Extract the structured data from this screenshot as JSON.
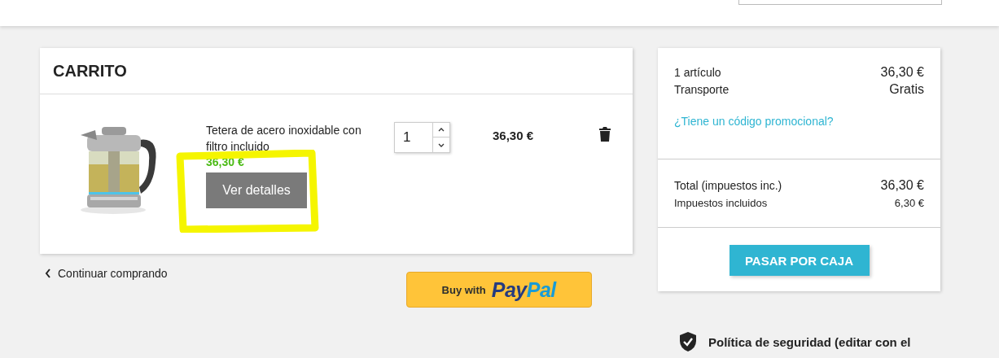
{
  "cart": {
    "title": "CARRITO",
    "items": [
      {
        "name": "Tetera de acero inoxidable con filtro incluido",
        "unit_price": "36,30 €",
        "details_button": "Ver detalles",
        "quantity": "1",
        "total": "36,30 €"
      }
    ],
    "continue_link": "Continuar comprando"
  },
  "paypal": {
    "label": "Buy with",
    "logo_parts": [
      "Pay",
      "Pal"
    ]
  },
  "summary": {
    "lines": [
      {
        "label": "1 artículo",
        "value": "36,30 €"
      },
      {
        "label": "Transporte",
        "value": "Gratis"
      }
    ],
    "promo_link": "¿Tiene un código promocional?",
    "totals": [
      {
        "kind": "total",
        "label": "Total (impuestos inc.)",
        "value": "36,30 €"
      },
      {
        "kind": "tax",
        "label": "Impuestos incluidos",
        "value": "6,30 €"
      }
    ],
    "checkout_button": "PASAR POR CAJA"
  },
  "policy": {
    "text": "Política de seguridad (editar con el"
  }
}
